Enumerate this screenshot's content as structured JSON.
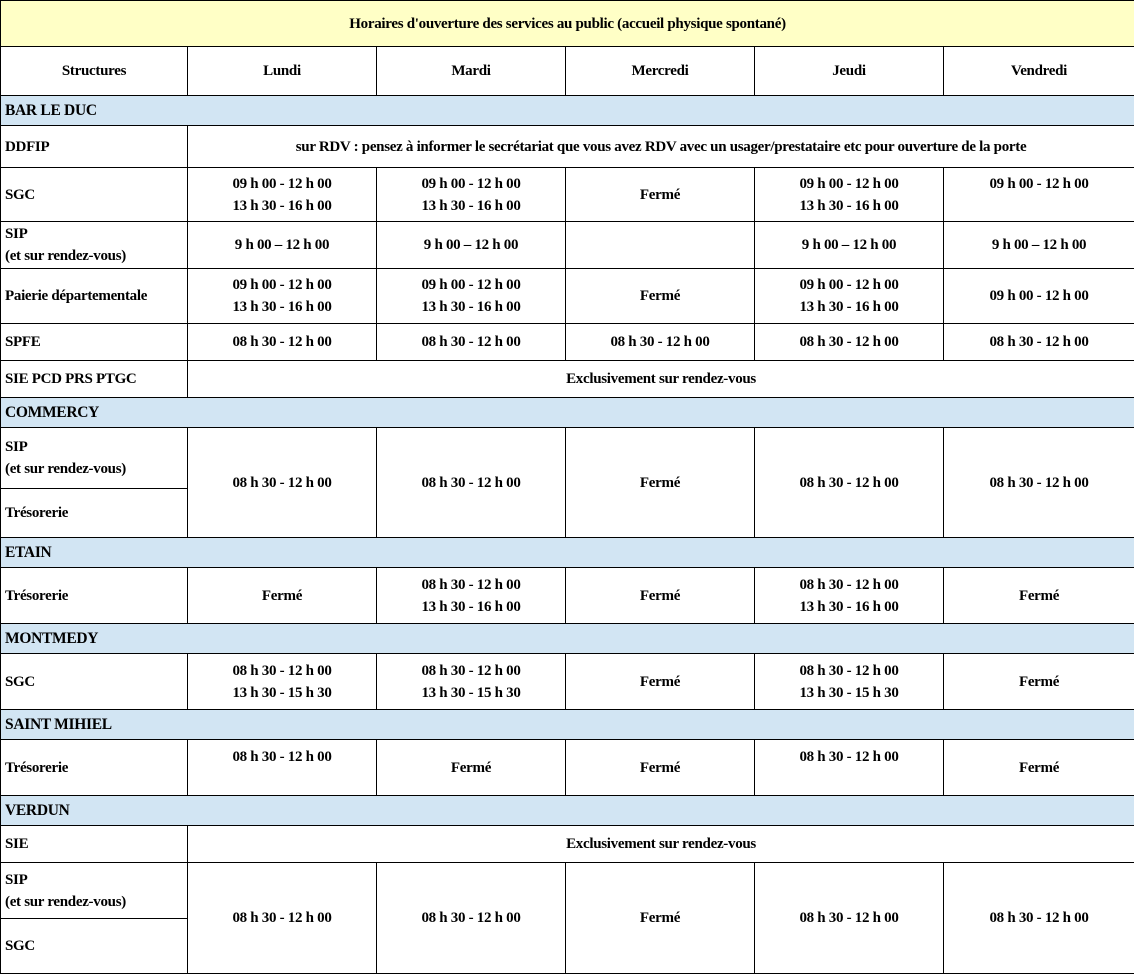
{
  "title": "Horaires d'ouverture des services au public (accueil physique spontané)",
  "columns": [
    "Structures",
    "Lundi",
    "Mardi",
    "Mercredi",
    "Jeudi",
    "Vendredi"
  ],
  "bar_le_duc": {
    "name": "BAR LE DUC",
    "ddfip": {
      "label": "DDFIP",
      "note": "sur RDV : pensez à informer le secrétariat que vous avez RDV avec un usager/prestataire etc pour ouverture de la porte"
    },
    "sgc": {
      "label": "SGC",
      "lundi": [
        "09 h 00 - 12 h 00",
        "13 h 30 - 16 h 00"
      ],
      "mardi": [
        "09 h 00 - 12 h 00",
        "13 h 30 - 16 h 00"
      ],
      "mercredi": "Fermé",
      "jeudi": [
        "09 h 00 - 12 h 00",
        "13 h 30 - 16 h 00"
      ],
      "vendredi": "09 h 00 - 12 h 00"
    },
    "sip": {
      "label": [
        "SIP",
        "(et sur rendez-vous)"
      ],
      "lundi": "9 h 00 – 12 h 00",
      "mardi": "9 h 00 – 12 h 00",
      "mercredi": "",
      "jeudi": "9 h 00 – 12 h 00",
      "vendredi": "9 h 00 – 12 h 00"
    },
    "paierie": {
      "label": "Paierie départementale",
      "lundi": [
        "09 h 00 - 12 h 00",
        "13 h 30 - 16 h 00"
      ],
      "mardi": [
        "09 h 00 - 12 h 00",
        "13 h 30 - 16 h 00"
      ],
      "mercredi": "Fermé",
      "jeudi": [
        "09 h 00 - 12 h 00",
        "13 h 30 - 16 h 00"
      ],
      "vendredi": "09 h 00 - 12 h 00"
    },
    "spfe": {
      "label": "SPFE",
      "lundi": "08 h 30 - 12 h 00",
      "mardi": "08 h 30 - 12 h 00",
      "mercredi": "08 h 30 - 12 h 00",
      "jeudi": "08 h 30 - 12 h 00",
      "vendredi": "08 h 30 - 12 h 00"
    },
    "sie": {
      "label": "SIE PCD PRS PTGC",
      "note": "Exclusivement sur rendez-vous"
    }
  },
  "commercy": {
    "name": "COMMERCY",
    "label1": [
      "SIP",
      "(et sur rendez-vous)"
    ],
    "label2": "Trésorerie",
    "lundi": "08 h 30 - 12 h 00",
    "mardi": "08 h 30 - 12 h 00",
    "mercredi": "Fermé",
    "jeudi": "08 h 30 - 12 h 00",
    "vendredi": "08 h 30 - 12 h 00"
  },
  "etain": {
    "name": "ETAIN",
    "tresorerie": {
      "label": "Trésorerie",
      "lundi": "Fermé",
      "mardi": [
        "08 h 30 - 12 h 00",
        "13 h 30 - 16 h 00"
      ],
      "mercredi": "Fermé",
      "jeudi": [
        "08 h 30 - 12 h 00",
        "13 h 30 - 16 h 00"
      ],
      "vendredi": "Fermé"
    }
  },
  "montmedy": {
    "name": "MONTMEDY",
    "sgc": {
      "label": "SGC",
      "lundi": [
        "08 h 30 - 12 h 00",
        "13 h 30 - 15 h 30"
      ],
      "mardi": [
        "08 h 30 - 12 h 00",
        "13 h 30 - 15 h 30"
      ],
      "mercredi": "Fermé",
      "jeudi": [
        "08 h 30 - 12 h 00",
        "13 h 30 - 15 h 30"
      ],
      "vendredi": "Fermé"
    }
  },
  "saint_mihiel": {
    "name": "SAINT MIHIEL",
    "tresorerie": {
      "label": "Trésorerie",
      "lundi": "08 h 30 - 12 h 00",
      "mardi": "Fermé",
      "mercredi": "Fermé",
      "jeudi": "08 h 30 - 12 h 00",
      "vendredi": "Fermé"
    }
  },
  "verdun": {
    "name": "VERDUN",
    "sie": {
      "label": "SIE",
      "note": "Exclusivement sur rendez-vous"
    },
    "label1": [
      "SIP",
      "(et sur rendez-vous)"
    ],
    "label2": "SGC",
    "lundi": "08 h 30 - 12 h 00",
    "mardi": "08 h 30 - 12 h 00",
    "mercredi": "Fermé",
    "jeudi": "08 h 30 - 12 h 00",
    "vendredi": "08 h 30 - 12 h 00"
  }
}
